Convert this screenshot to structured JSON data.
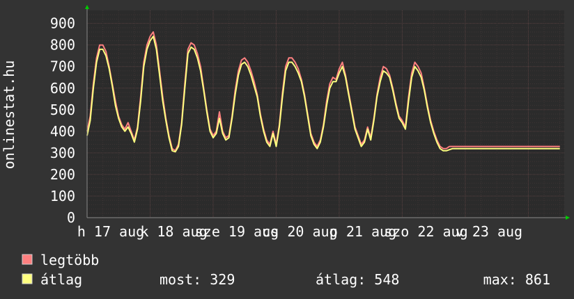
{
  "chart_data": {
    "type": "line",
    "ylabel": "onlinestat.hu",
    "ylim": [
      0,
      960
    ],
    "grid": true,
    "x_range_days": [
      0,
      7.57
    ],
    "yticks": [
      0,
      100,
      200,
      300,
      400,
      500,
      600,
      700,
      800,
      900
    ],
    "xtick_labels": [
      "h 17 aug",
      "k 18 aug",
      "sze 19 aug",
      "cs 20 aug",
      "p 21 aug",
      "szo 22 aug",
      "v 23 aug"
    ],
    "xtick_positions_days": [
      0,
      1,
      2,
      3,
      4,
      5,
      6
    ],
    "series": [
      {
        "name": "legtöbb",
        "color": "#ff8080",
        "x": [
          0,
          0.05,
          0.1,
          0.15,
          0.2,
          0.25,
          0.3,
          0.35,
          0.4,
          0.45,
          0.5,
          0.55,
          0.6,
          0.65,
          0.7,
          0.75,
          0.8,
          0.85,
          0.9,
          0.95,
          1,
          1.05,
          1.1,
          1.15,
          1.2,
          1.25,
          1.3,
          1.35,
          1.4,
          1.45,
          1.5,
          1.55,
          1.6,
          1.65,
          1.7,
          1.75,
          1.8,
          1.85,
          1.9,
          1.95,
          2,
          2.05,
          2.1,
          2.15,
          2.2,
          2.25,
          2.3,
          2.35,
          2.4,
          2.45,
          2.5,
          2.55,
          2.6,
          2.65,
          2.7,
          2.75,
          2.8,
          2.85,
          2.9,
          2.95,
          3,
          3.05,
          3.1,
          3.15,
          3.2,
          3.25,
          3.3,
          3.35,
          3.4,
          3.45,
          3.5,
          3.55,
          3.6,
          3.65,
          3.7,
          3.75,
          3.8,
          3.85,
          3.9,
          3.95,
          4,
          4.05,
          4.1,
          4.15,
          4.2,
          4.25,
          4.3,
          4.35,
          4.4,
          4.45,
          4.5,
          4.55,
          4.6,
          4.65,
          4.7,
          4.75,
          4.8,
          4.85,
          4.9,
          4.95,
          5,
          5.05,
          5.1,
          5.15,
          5.2,
          5.25,
          5.3,
          5.35,
          5.4,
          5.45,
          5.5,
          5.55,
          5.6,
          5.65,
          5.7,
          5.75,
          5.8,
          5.85,
          5.9,
          5.95,
          6,
          6.05,
          6.1,
          6.15,
          6.2,
          6.25,
          6.3,
          6.35,
          6.4,
          6.45,
          6.5,
          6.55,
          6.6,
          6.65,
          6.7,
          6.75,
          6.8,
          6.85,
          6.9,
          6.95,
          7,
          7.05,
          7.1,
          7.15,
          7.2,
          7.25,
          7.3,
          7.35,
          7.4,
          7.45,
          7.5
        ],
        "values": [
          400,
          470,
          620,
          740,
          800,
          800,
          770,
          700,
          620,
          540,
          470,
          430,
          410,
          440,
          400,
          360,
          420,
          560,
          720,
          800,
          840,
          860,
          800,
          680,
          560,
          460,
          380,
          320,
          310,
          340,
          440,
          620,
          780,
          810,
          800,
          760,
          700,
          600,
          500,
          410,
          380,
          400,
          490,
          400,
          370,
          380,
          470,
          590,
          680,
          730,
          740,
          720,
          680,
          630,
          570,
          480,
          410,
          360,
          340,
          400,
          340,
          430,
          580,
          700,
          740,
          740,
          720,
          690,
          640,
          570,
          480,
          390,
          350,
          330,
          360,
          430,
          540,
          620,
          650,
          640,
          690,
          720,
          660,
          580,
          500,
          420,
          380,
          340,
          360,
          420,
          370,
          460,
          570,
          650,
          700,
          690,
          660,
          600,
          530,
          470,
          450,
          420,
          560,
          670,
          720,
          700,
          670,
          600,
          520,
          450,
          400,
          360,
          330,
          320,
          320,
          330,
          330,
          330,
          330,
          330,
          330,
          330,
          330,
          330,
          330,
          330,
          330,
          330,
          330,
          330,
          330,
          330,
          330,
          330,
          330,
          330,
          330,
          330,
          330,
          330,
          330,
          330,
          330,
          330,
          330,
          330,
          330,
          330,
          330,
          330,
          330
        ]
      },
      {
        "name": "átlag",
        "color": "#ffff80",
        "x": [
          0,
          0.05,
          0.1,
          0.15,
          0.2,
          0.25,
          0.3,
          0.35,
          0.4,
          0.45,
          0.5,
          0.55,
          0.6,
          0.65,
          0.7,
          0.75,
          0.8,
          0.85,
          0.9,
          0.95,
          1,
          1.05,
          1.1,
          1.15,
          1.2,
          1.25,
          1.3,
          1.35,
          1.4,
          1.45,
          1.5,
          1.55,
          1.6,
          1.65,
          1.7,
          1.75,
          1.8,
          1.85,
          1.9,
          1.95,
          2,
          2.05,
          2.1,
          2.15,
          2.2,
          2.25,
          2.3,
          2.35,
          2.4,
          2.45,
          2.5,
          2.55,
          2.6,
          2.65,
          2.7,
          2.75,
          2.8,
          2.85,
          2.9,
          2.95,
          3,
          3.05,
          3.1,
          3.15,
          3.2,
          3.25,
          3.3,
          3.35,
          3.4,
          3.45,
          3.5,
          3.55,
          3.6,
          3.65,
          3.7,
          3.75,
          3.8,
          3.85,
          3.9,
          3.95,
          4,
          4.05,
          4.1,
          4.15,
          4.2,
          4.25,
          4.3,
          4.35,
          4.4,
          4.45,
          4.5,
          4.55,
          4.6,
          4.65,
          4.7,
          4.75,
          4.8,
          4.85,
          4.9,
          4.95,
          5,
          5.05,
          5.1,
          5.15,
          5.2,
          5.25,
          5.3,
          5.35,
          5.4,
          5.45,
          5.5,
          5.55,
          5.6,
          5.65,
          5.7,
          5.75,
          5.8,
          5.85,
          5.9,
          5.95,
          6,
          6.05,
          6.1,
          6.15,
          6.2,
          6.25,
          6.3,
          6.35,
          6.4,
          6.45,
          6.5,
          6.55,
          6.6,
          6.65,
          6.7,
          6.75,
          6.8,
          6.85,
          6.9,
          6.95,
          7,
          7.05,
          7.1,
          7.15,
          7.2,
          7.25,
          7.3,
          7.35,
          7.4,
          7.45,
          7.5
        ],
        "values": [
          380,
          450,
          600,
          720,
          780,
          780,
          750,
          690,
          610,
          520,
          460,
          420,
          400,
          420,
          390,
          350,
          410,
          540,
          700,
          780,
          820,
          840,
          780,
          660,
          540,
          450,
          370,
          310,
          305,
          330,
          430,
          600,
          760,
          790,
          780,
          740,
          680,
          590,
          490,
          400,
          370,
          390,
          460,
          390,
          360,
          370,
          460,
          570,
          660,
          710,
          720,
          700,
          660,
          610,
          560,
          470,
          400,
          350,
          330,
          390,
          330,
          420,
          560,
          680,
          720,
          720,
          700,
          670,
          630,
          560,
          470,
          380,
          340,
          320,
          350,
          420,
          520,
          600,
          630,
          630,
          670,
          700,
          650,
          570,
          490,
          410,
          370,
          330,
          350,
          410,
          360,
          450,
          560,
          630,
          680,
          670,
          650,
          590,
          520,
          460,
          440,
          410,
          540,
          650,
          700,
          680,
          650,
          590,
          510,
          440,
          390,
          350,
          320,
          310,
          310,
          315,
          320,
          320,
          320,
          320,
          320,
          320,
          320,
          320,
          320,
          320,
          320,
          320,
          320,
          320,
          320,
          320,
          320,
          320,
          320,
          320,
          320,
          320,
          320,
          320,
          320,
          320,
          320,
          320,
          320,
          320,
          320,
          320,
          320,
          320,
          320
        ]
      }
    ]
  },
  "legend": {
    "max_label": "legtöbb",
    "avg_label": "átlag",
    "max_color": "#ff8080",
    "avg_color": "#ffff80",
    "stats": {
      "most": "most: 329",
      "atlag": "átlag: 548",
      "max": "max: 861"
    }
  }
}
